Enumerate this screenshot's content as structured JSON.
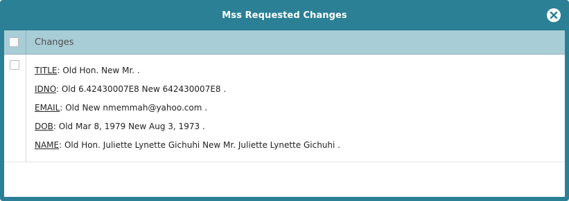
{
  "dialog": {
    "title": "Mss Requested Changes"
  },
  "table": {
    "header": "Changes",
    "rows": [
      {
        "lines": [
          {
            "field": "TITLE",
            "text": ": Old Hon. New Mr. ."
          },
          {
            "field": "IDNO",
            "text": ": Old 6.42430007E8 New 642430007E8 ."
          },
          {
            "field": "EMAIL",
            "text": ": Old New nmemmah@yahoo.com ."
          },
          {
            "field": "DOB",
            "text": ": Old Mar 8, 1979 New Aug 3, 1973 ."
          },
          {
            "field": "NAME",
            "text": ": Old Hon. Juliette Lynette Gichuhi New Mr. Juliette Lynette Gichuhi ."
          }
        ]
      }
    ]
  },
  "icons": {
    "close": "close-circle-icon"
  },
  "colors": {
    "titlebar": "#2b8095",
    "header": "#a9cdd7"
  }
}
